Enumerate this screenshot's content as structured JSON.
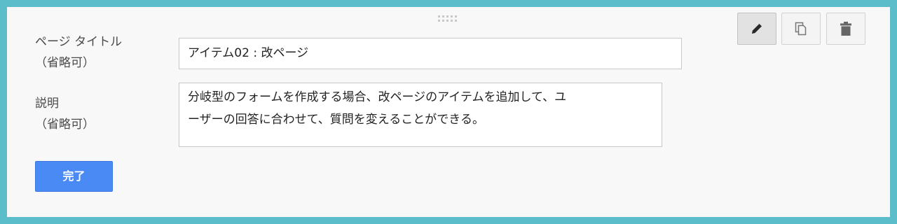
{
  "form": {
    "title_label_line1": "ページ タイトル",
    "title_label_line2": "（省略可）",
    "title_value": "アイテム02 : 改ページ",
    "desc_label_line1": "説明",
    "desc_label_line2": "（省略可）",
    "desc_line1": "分岐型のフォームを作成する場合、改ページのアイテムを追加して、ユ",
    "desc_line2": "ーザーの回答に合わせて、質問を変えることができる。",
    "done_label": "完了"
  },
  "toolbar": {
    "icons": [
      "pencil-icon",
      "copy-icon",
      "trash-icon"
    ]
  },
  "colors": {
    "frame": "#5bbcca",
    "panel": "#f8f8f8",
    "done_button": "#4a8af4"
  }
}
